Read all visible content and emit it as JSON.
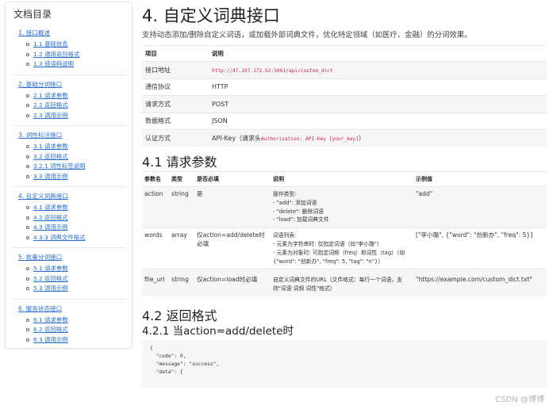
{
  "toc": {
    "title": "文档目录",
    "groups": [
      {
        "label": "1. 接口概述",
        "items": [
          "1.1 基础信息",
          "1.2 通用返回格式",
          "1.3 错误码说明"
        ]
      },
      {
        "label": "2. 基础分词接口",
        "items": [
          "2.1 请求参数",
          "2.2 返回格式",
          "2.3 调用示例"
        ]
      },
      {
        "label": "3. 词性标注接口",
        "items": [
          "3.1 请求参数",
          "3.2 返回格式",
          "3.2.1 词性标签说明",
          "3.3 调用示例"
        ]
      },
      {
        "label": "4. 自定义词典接口",
        "items": [
          "4.1 请求参数",
          "4.2 返回格式",
          "4.3 调用示例",
          "4.3.3 词典文件格式"
        ]
      },
      {
        "label": "5. 批量分词接口",
        "items": [
          "5.1 请求参数",
          "5.2 返回格式",
          "5.3 调用示例"
        ]
      },
      {
        "label": "6. 服务状态接口",
        "items": [
          "6.1 请求参数",
          "6.2 返回格式",
          "6.3 调用示例"
        ]
      }
    ]
  },
  "main": {
    "title": "4. 自定义词典接口",
    "description": "支持动态添加/删除自定义词语，或加载外部词典文件，优化特定领域（如医疗、金融）的分词效果。",
    "info_table": {
      "headers": [
        "项目",
        "说明"
      ],
      "rows": [
        {
          "k": "接口地址",
          "v": "",
          "code": "http://47.107.172.52:5001/api/custom_dict"
        },
        {
          "k": "通信协议",
          "v": "HTTP",
          "code": ""
        },
        {
          "k": "请求方式",
          "v": "POST",
          "code": ""
        },
        {
          "k": "数据格式",
          "v": "JSON",
          "code": ""
        },
        {
          "k": "认证方式",
          "v": "API-Key（请求头",
          "code": "Authorization: API-Key [your_key]",
          "suffix": "）"
        }
      ]
    },
    "section_41": "4.1 请求参数",
    "param_table": {
      "headers": [
        "参数名",
        "类型",
        "是否必填",
        "说明",
        "示例值"
      ],
      "rows": [
        {
          "name": "action",
          "type": "string",
          "required": "是",
          "desc": [
            "操作类型:",
            "- \"add\": 添加词语",
            "- \"delete\": 删除词语",
            "- \"load\": 加载词典文件"
          ],
          "example": "\"add\""
        },
        {
          "name": "words",
          "type": "array",
          "required": "仅action=add/delete时必填",
          "desc": [
            "词语列表:",
            "- 元素为字符串时: 仅指定词语（如\"李小璐\"）",
            "- 元素为对象时: 可指定词频（freq）和词性（tag）（如{\"word\": \"创新办\", \"freq\": 5, \"tag\": \"n\"}）"
          ],
          "example": "[\"李小璐\", {\"word\": \"创新办\", \"freq\": 5}]"
        },
        {
          "name": "file_url",
          "type": "string",
          "required": "仅action=load时必填",
          "desc": [
            "自定义词典文件的URL（文件格式：每行一个词语，支持\"词语 词频 词性\"格式）"
          ],
          "example": "\"https://example.com/custom_dict.txt\""
        }
      ]
    },
    "section_42": "4.2 返回格式",
    "section_421": "4.2.1 当action=add/delete时",
    "code_lines": [
      "{",
      "  \"code\": 0,",
      "  \"message\": \"success\",",
      "  \"data\": {"
    ]
  },
  "watermark": "CSDN @博博"
}
